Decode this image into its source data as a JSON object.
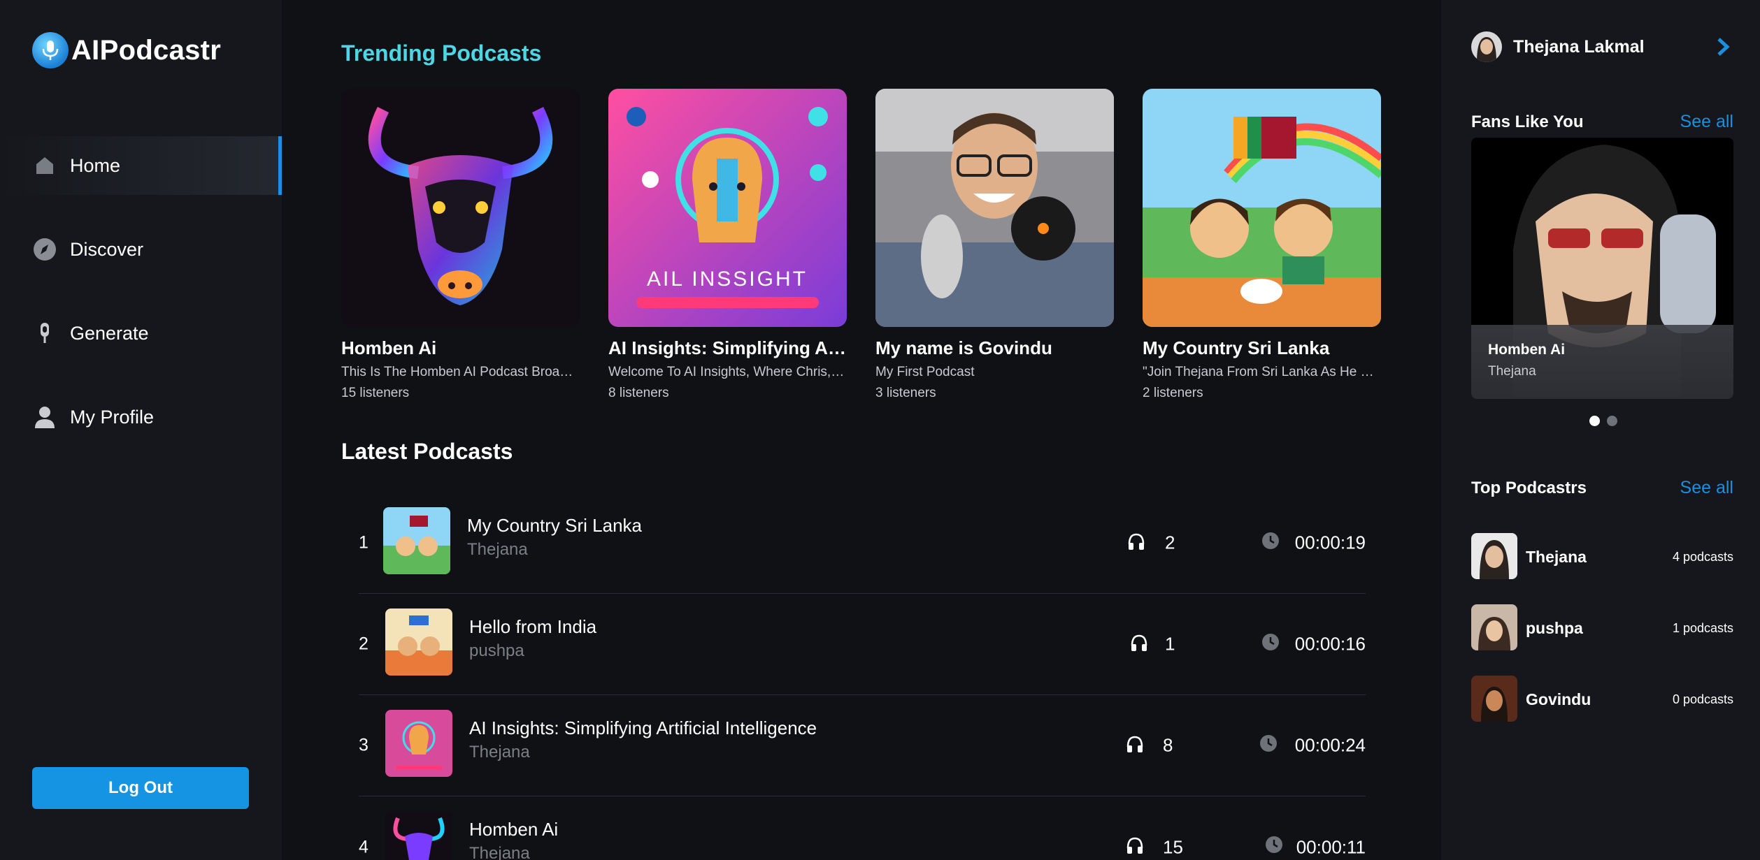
{
  "app": {
    "name": "AIPodcastr"
  },
  "nav": {
    "items": [
      {
        "label": "Home",
        "icon": "home-icon",
        "active": true
      },
      {
        "label": "Discover",
        "icon": "compass-icon",
        "active": false
      },
      {
        "label": "Generate",
        "icon": "microphone-icon",
        "active": false
      },
      {
        "label": "My Profile",
        "icon": "user-icon",
        "active": false
      }
    ],
    "logout_label": "Log Out"
  },
  "trending": {
    "title": "Trending Podcasts",
    "items": [
      {
        "title": "Homben Ai",
        "description": "This Is The Homben AI Podcast Broadcasting Today",
        "listeners": "15 listeners"
      },
      {
        "title": "AI Insights: Simplifying Artificial Intelligence",
        "description": "Welcome To AI Insights, Where Chris, Alex And Friends",
        "listeners": "8 listeners"
      },
      {
        "title": "My name is Govindu",
        "description": "My First Podcast",
        "listeners": "3 listeners"
      },
      {
        "title": "My Country Sri Lanka",
        "description": "\"Join Thejana From Sri Lanka As He Shares His Country",
        "listeners": "2 listeners"
      }
    ],
    "artwork_text": {
      "ai_insight": "AIL INSSIGHT"
    }
  },
  "latest": {
    "title": "Latest Podcasts",
    "rows": [
      {
        "num": "1",
        "title": "My Country Sri Lanka",
        "author": "Thejana",
        "listeners": "2",
        "duration": "00:00:19"
      },
      {
        "num": "2",
        "title": "Hello from India",
        "author": "pushpa",
        "listeners": "1",
        "duration": "00:00:16"
      },
      {
        "num": "3",
        "title": "AI Insights: Simplifying Artificial Intelligence",
        "author": "Thejana",
        "listeners": "8",
        "duration": "00:00:24"
      },
      {
        "num": "4",
        "title": "Homben Ai",
        "author": "Thejana",
        "listeners": "15",
        "duration": "00:00:11"
      }
    ]
  },
  "right": {
    "user_name": "Thejana Lakmal",
    "fans": {
      "title": "Fans Like You",
      "see_all": "See all",
      "featured_title": "Homben Ai",
      "featured_author": "Thejana",
      "slides": 2,
      "active_slide": 1
    },
    "top": {
      "title": "Top Podcastrs",
      "see_all": "See all",
      "items": [
        {
          "name": "Thejana",
          "count": "4 podcasts"
        },
        {
          "name": "pushpa",
          "count": "1 podcasts"
        },
        {
          "name": "Govindu",
          "count": "0 podcasts"
        }
      ]
    }
  },
  "colors": {
    "accent": "#1494e2",
    "trending_title": "#4fd6e6",
    "background": "#101114",
    "sidebar": "#15171c"
  }
}
